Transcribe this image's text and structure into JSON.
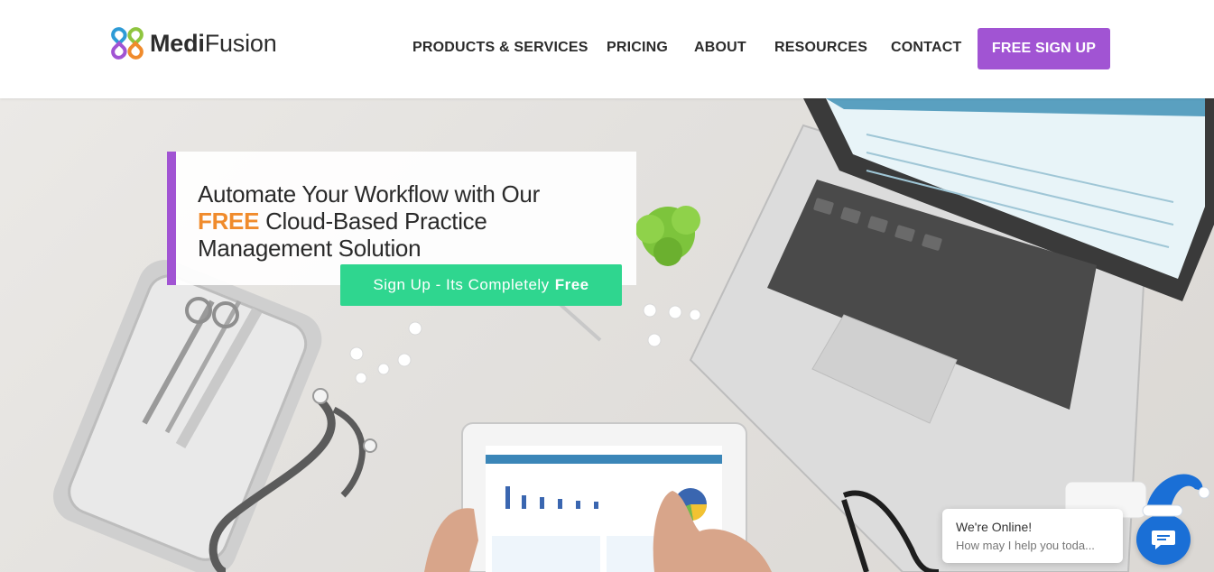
{
  "brand": {
    "name_bold": "Medi",
    "name_light": "Fusion",
    "logo_colors": [
      "#2e9bd6",
      "#8fc53f",
      "#f08b2c",
      "#a154d3"
    ]
  },
  "nav": {
    "items": [
      {
        "label": "PRODUCTS & SERVICES"
      },
      {
        "label": "PRICING"
      },
      {
        "label": "ABOUT"
      },
      {
        "label": "RESOURCES"
      },
      {
        "label": "CONTACT"
      }
    ],
    "signup_label": "FREE SIGN UP"
  },
  "hero": {
    "title_line1": "Automate Your Workflow with Our",
    "title_highlight": "FREE",
    "title_line2_rest": " Cloud-Based Practice",
    "title_line3": "Management Solution",
    "cta_prefix": "Sign Up - Its Completely",
    "cta_bold": "Free"
  },
  "chat": {
    "status": "We're Online!",
    "prompt": "How may I help you toda..."
  },
  "colors": {
    "accent_purple": "#a154d3",
    "cta_green": "#2fd68f",
    "highlight_orange": "#f08b2c",
    "chat_blue": "#1a6fd6"
  },
  "icons": {
    "logo": "medifusion-logo-icon",
    "chat": "chat-bubble-icon",
    "hat": "santa-hat-icon"
  }
}
